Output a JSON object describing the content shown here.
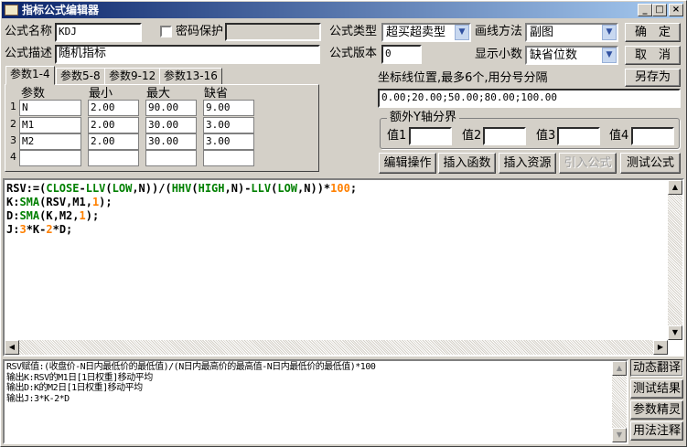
{
  "window": {
    "title": "指标公式编辑器",
    "min": "_",
    "max": "□",
    "close": "×"
  },
  "form": {
    "name_label": "公式名称",
    "name_value": "KDJ",
    "password_label": "密码保护",
    "password_value": "",
    "desc_label": "公式描述",
    "desc_value": "随机指标",
    "type_label": "公式类型",
    "type_value": "超买超卖型",
    "draw_label": "画线方法",
    "draw_value": "副图",
    "version_label": "公式版本",
    "version_value": "0",
    "decimal_label": "显示小数",
    "decimal_value": "缺省位数"
  },
  "buttons": {
    "ok": "确　定",
    "cancel": "取　消",
    "save_as": "另存为"
  },
  "tabs": [
    "参数1-4",
    "参数5-8",
    "参数9-12",
    "参数13-16"
  ],
  "params": {
    "headers": [
      "参数",
      "最小",
      "最大",
      "缺省"
    ],
    "rows": [
      {
        "n": "1",
        "name": "N",
        "min": "2.00",
        "max": "90.00",
        "def": "9.00"
      },
      {
        "n": "2",
        "name": "M1",
        "min": "2.00",
        "max": "30.00",
        "def": "3.00"
      },
      {
        "n": "3",
        "name": "M2",
        "min": "2.00",
        "max": "30.00",
        "def": "3.00"
      },
      {
        "n": "4",
        "name": "",
        "min": "",
        "max": "",
        "def": ""
      }
    ]
  },
  "axis": {
    "label": "坐标线位置,最多6个,用分号分隔",
    "value": "0.00;20.00;50.00;80.00;100.00"
  },
  "yaxis": {
    "title": "额外Y轴分界",
    "labels": [
      "值1",
      "值2",
      "值3",
      "值4"
    ],
    "values": [
      "",
      "",
      "",
      ""
    ]
  },
  "actions": {
    "edit": "编辑操作",
    "insert_func": "插入函数",
    "insert_res": "插入资源",
    "import": "引入公式",
    "test": "测试公式"
  },
  "colors": {
    "keyword": "#008000",
    "number": "#ff8000",
    "text": "#000000"
  },
  "code": [
    [
      {
        "t": "RSV:=(",
        "c": "text"
      },
      {
        "t": "CLOSE",
        "c": "keyword"
      },
      {
        "t": "-",
        "c": "text"
      },
      {
        "t": "LLV",
        "c": "keyword"
      },
      {
        "t": "(",
        "c": "text"
      },
      {
        "t": "LOW",
        "c": "keyword"
      },
      {
        "t": ",N))/(",
        "c": "text"
      },
      {
        "t": "HHV",
        "c": "keyword"
      },
      {
        "t": "(",
        "c": "text"
      },
      {
        "t": "HIGH",
        "c": "keyword"
      },
      {
        "t": ",N)-",
        "c": "text"
      },
      {
        "t": "LLV",
        "c": "keyword"
      },
      {
        "t": "(",
        "c": "text"
      },
      {
        "t": "LOW",
        "c": "keyword"
      },
      {
        "t": ",N))*",
        "c": "text"
      },
      {
        "t": "100",
        "c": "number"
      },
      {
        "t": ";",
        "c": "text"
      }
    ],
    [
      {
        "t": "K:",
        "c": "text"
      },
      {
        "t": "SMA",
        "c": "keyword"
      },
      {
        "t": "(RSV,M1,",
        "c": "text"
      },
      {
        "t": "1",
        "c": "number"
      },
      {
        "t": ");",
        "c": "text"
      }
    ],
    [
      {
        "t": "D:",
        "c": "text"
      },
      {
        "t": "SMA",
        "c": "keyword"
      },
      {
        "t": "(K,M2,",
        "c": "text"
      },
      {
        "t": "1",
        "c": "number"
      },
      {
        "t": ");",
        "c": "text"
      }
    ],
    [
      {
        "t": "J:",
        "c": "text"
      },
      {
        "t": "3",
        "c": "number"
      },
      {
        "t": "*K-",
        "c": "text"
      },
      {
        "t": "2",
        "c": "number"
      },
      {
        "t": "*D;",
        "c": "text"
      }
    ]
  ],
  "translation": [
    "RSV赋值:(收盘价-N日内最低价的最低值)/(N日内最高价的最高值-N日内最低价的最低值)*100",
    "输出K:RSV的M1日[1日权重]移动平均",
    "输出D:K的M2日[1日权重]移动平均",
    "输出J:3*K-2*D"
  ],
  "side_buttons": {
    "translate": "动态翻译",
    "result": "测试结果",
    "wizard": "参数精灵",
    "notes": "用法注释"
  }
}
